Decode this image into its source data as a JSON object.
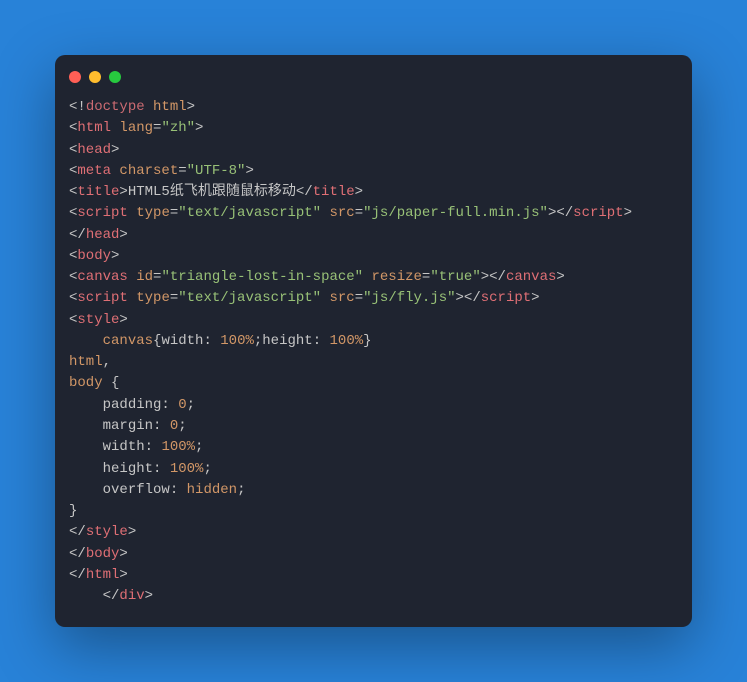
{
  "window": {
    "dots": [
      "red",
      "yellow",
      "green"
    ]
  },
  "code": {
    "doctype": "doctype",
    "html_kw": "html",
    "lang_val": "\"zh\"",
    "charset_val": "\"UTF-8\"",
    "title_text": "HTML5纸飞机跟随鼠标移动",
    "tjs_val": "\"text/javascript\"",
    "src1_val": "\"js/paper-full.min.js\"",
    "src2_val": "\"js/fly.js\"",
    "id_val": "\"triangle-lost-in-space\"",
    "resize_val": "\"true\"",
    "w100": "100%",
    "h100": "100%",
    "zero": "0",
    "hidden": "hidden",
    "t": {
      "html": "html",
      "head": "head",
      "meta": "meta",
      "title": "title",
      "script": "script",
      "body": "body",
      "canvas": "canvas",
      "style": "style",
      "div": "div"
    },
    "a": {
      "lang": "lang",
      "charset": "charset",
      "type": "type",
      "src": "src",
      "id": "id",
      "resize": "resize"
    },
    "css": {
      "canvas_sel": "canvas",
      "html_sel": "html",
      "body_sel": "body",
      "width": "width",
      "height": "height",
      "padding": "padding",
      "margin": "margin",
      "overflow": "overflow"
    }
  }
}
